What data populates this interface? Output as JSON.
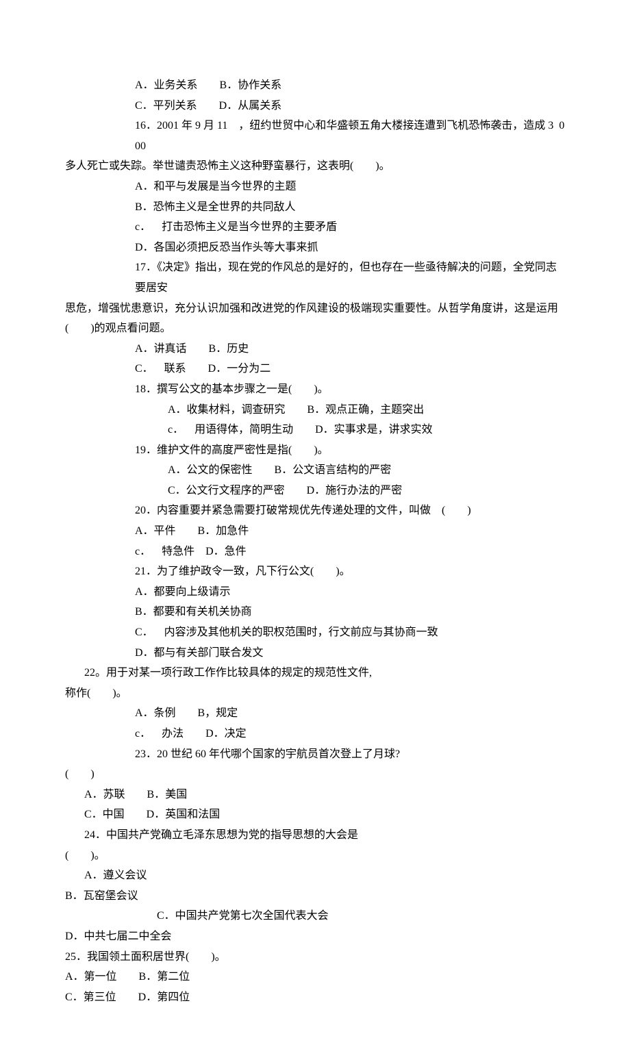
{
  "lines": [
    {
      "cls": "i2",
      "text": "A．业务关系        B．协作关系"
    },
    {
      "cls": "i2",
      "text": "C．平列关系        D．从属关系"
    },
    {
      "cls": "i2",
      "text": "16．2001 年 9 月 11    ，纽约世贸中心和华盛顿五角大楼接连遭到飞机恐怖袭击，造成 3  000"
    },
    {
      "cls": "i0",
      "text": "多人死亡或失踪。举世谴责恐怖主义这种野蛮暴行，这表明(        )。"
    },
    {
      "cls": "i2",
      "text": "A．和平与发展是当今世界的主题"
    },
    {
      "cls": "i2",
      "text": "B．恐怖主义是全世界的共同敌人"
    },
    {
      "cls": "i2",
      "text": "c．    打击恐怖主义是当今世界的主要矛盾"
    },
    {
      "cls": "i2",
      "text": "D．各国必须把反恐当作头等大事来抓"
    },
    {
      "cls": "i2",
      "text": "17．《决定》指出，现在党的作风总的是好的，但也存在一些亟待解决的问题，全党同志要居安"
    },
    {
      "cls": "i0",
      "text": "思危，增强忧患意识，充分认识加强和改进党的作风建设的极端现实重要性。从哲学角度讲，这是运用"
    },
    {
      "cls": "i0",
      "text": "(        )的观点看问题。"
    },
    {
      "cls": "i2",
      "text": "A．讲真话        B．历史"
    },
    {
      "cls": "i2",
      "text": "C．    联系        D．一分为二"
    },
    {
      "cls": "i2",
      "text": "18．撰写公文的基本步骤之一是(        )。"
    },
    {
      "cls": "i3b",
      "text": "A．收集材料，调查研究        B．观点正确，主题突出"
    },
    {
      "cls": "i3b",
      "text": "c．    用语得体，简明生动        D．实事求是，讲求实效"
    },
    {
      "cls": "i2",
      "text": "19．维护文件的高度严密性是指(        )。"
    },
    {
      "cls": "i3b",
      "text": "A．公文的保密性        B．公文语言结构的严密"
    },
    {
      "cls": "i3b",
      "text": "C．公文行文程序的严密        D．施行办法的严密"
    },
    {
      "cls": "i2",
      "text": "20．内容重要并紧急需要打破常规优先传递处理的文件，叫做    (        )"
    },
    {
      "cls": "i2",
      "text": "A．平件        B．加急件"
    },
    {
      "cls": "i2",
      "text": "c．    特急件    D．急件"
    },
    {
      "cls": "i2",
      "text": "21．为了维护政令一致，凡下行公文(        )。"
    },
    {
      "cls": "i2",
      "text": "A．都要向上级请示"
    },
    {
      "cls": "i2",
      "text": "B．都要和有关机关协商"
    },
    {
      "cls": "i2",
      "text": "C．    内容涉及其他机关的职权范围时，行文前应与其协商一致"
    },
    {
      "cls": "i2",
      "text": "D．都与有关部门联合发文"
    },
    {
      "cls": "i1",
      "text": "22。用于对某一项行政工作作比较具体的规定的规范性文件,"
    },
    {
      "cls": "i0",
      "text": "称作(        )。"
    },
    {
      "cls": "i2",
      "text": "A．条例        B，规定"
    },
    {
      "cls": "i2",
      "text": "c．    办法        D．决定"
    },
    {
      "cls": "i2",
      "text": "23．20 世纪 60 年代哪个国家的宇航员首次登上了月球?"
    },
    {
      "cls": "i0",
      "text": "(        )"
    },
    {
      "cls": "i1",
      "text": "A．苏联        B．美国"
    },
    {
      "cls": "i1",
      "text": "C．中国        D．英国和法国"
    },
    {
      "cls": "i1",
      "text": "24．中国共产党确立毛泽东思想为党的指导思想的大会是"
    },
    {
      "cls": "i0",
      "text": "(        )。"
    },
    {
      "cls": "i1",
      "text": "A．遵义会议"
    },
    {
      "cls": "i0",
      "text": "B．瓦窑堡会议"
    },
    {
      "cls": "i3",
      "text": "C．中国共产党第七次全国代表大会"
    },
    {
      "cls": "i0",
      "text": "D．中共七届二中全会"
    },
    {
      "cls": "i0",
      "text": "25．我国领土面积居世界(        )。"
    },
    {
      "cls": "i0",
      "text": "A．第一位        B．第二位"
    },
    {
      "cls": "i0",
      "text": "C．第三位        D．第四位"
    }
  ]
}
